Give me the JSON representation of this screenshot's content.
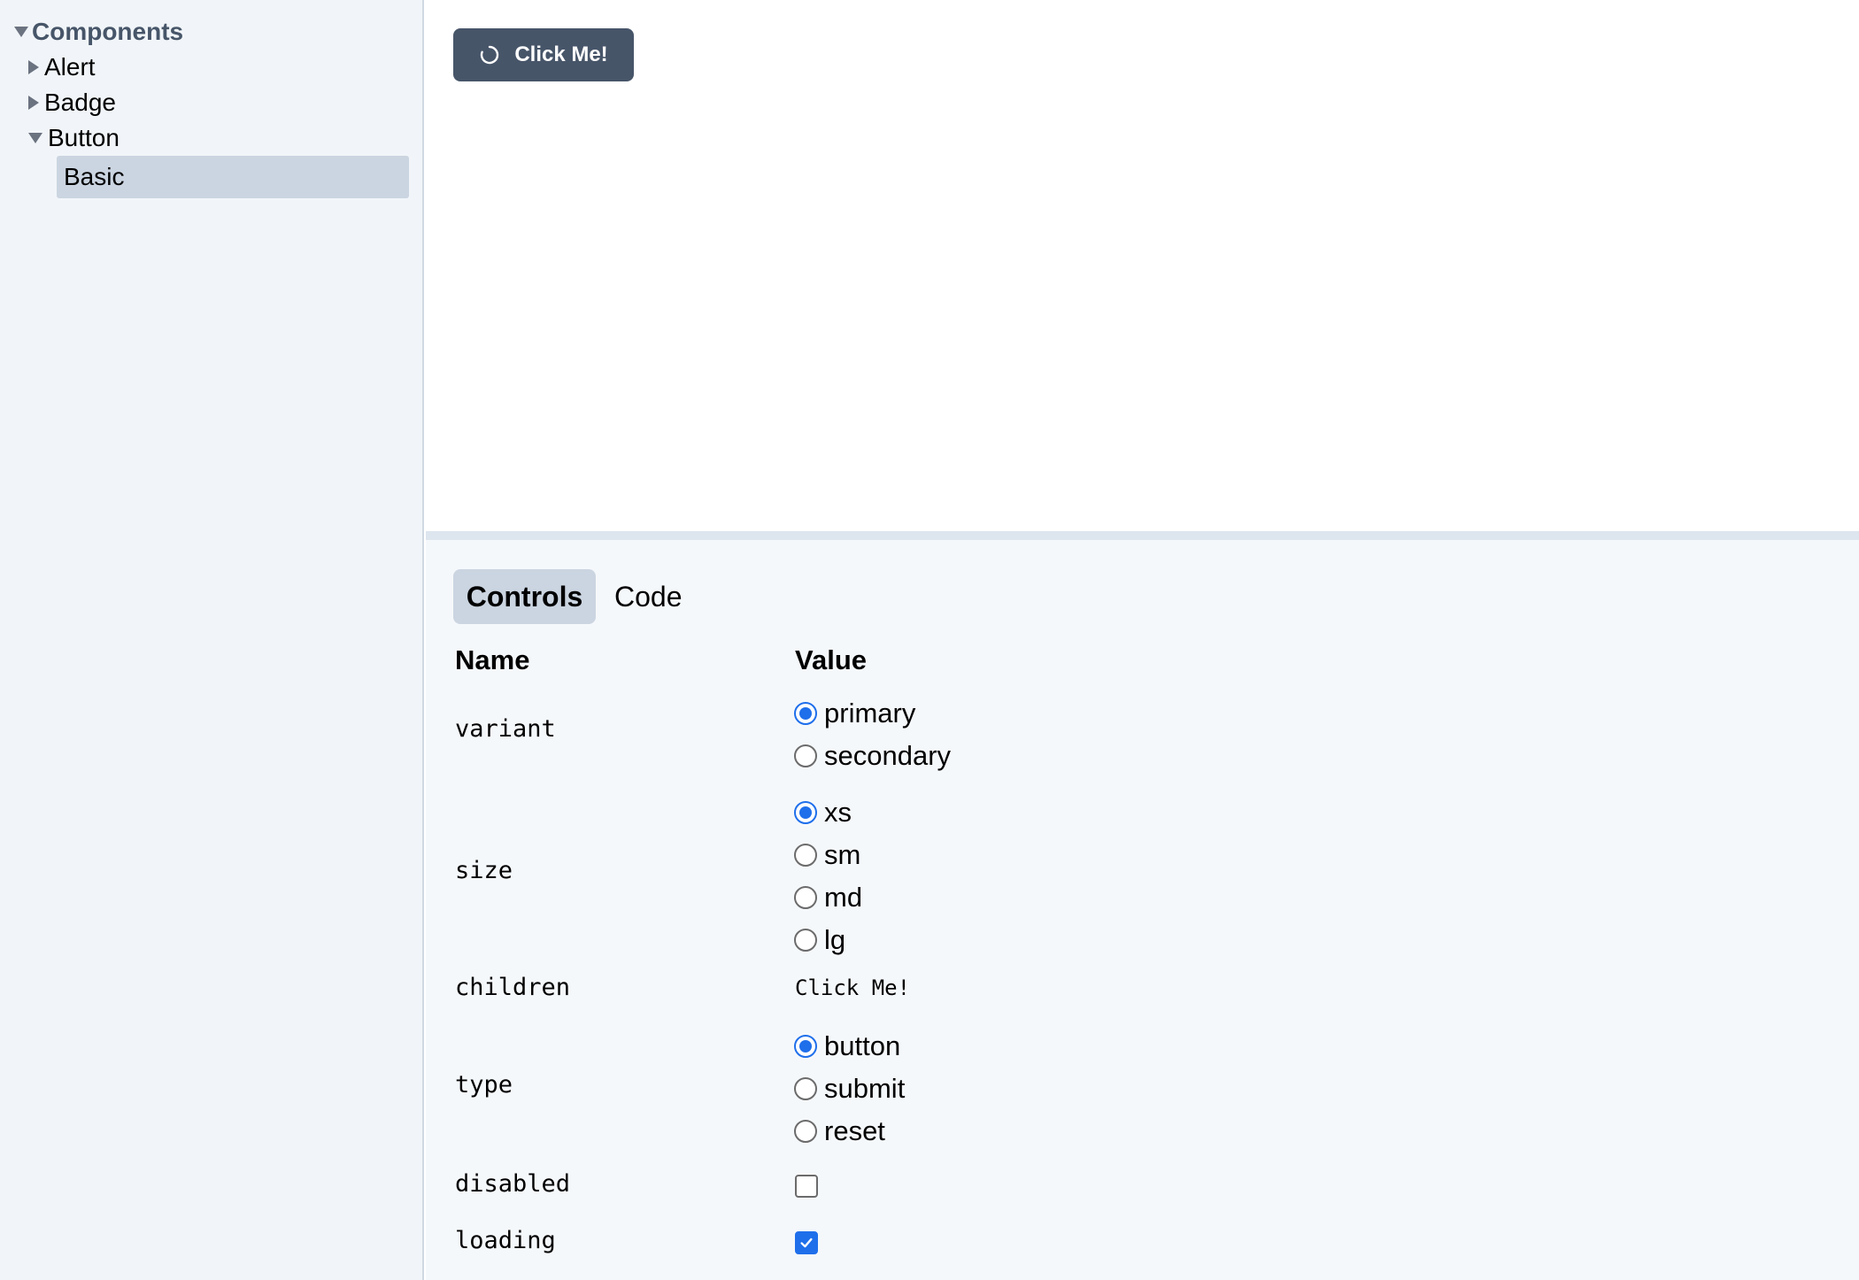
{
  "sidebar": {
    "root": {
      "label": "Components",
      "expanded": true
    },
    "groups": [
      {
        "label": "Alert",
        "expanded": false
      },
      {
        "label": "Badge",
        "expanded": false
      },
      {
        "label": "Button",
        "expanded": true
      }
    ],
    "selected_story": "Basic"
  },
  "preview": {
    "button_label": "Click Me!",
    "button_color": "#475569"
  },
  "panel": {
    "tabs": [
      {
        "label": "Controls",
        "active": true
      },
      {
        "label": "Code",
        "active": false
      }
    ],
    "columns": {
      "name": "Name",
      "value": "Value"
    },
    "props": {
      "variant": {
        "name": "variant",
        "options": [
          "primary",
          "secondary"
        ],
        "selected": "primary"
      },
      "size": {
        "name": "size",
        "options": [
          "xs",
          "sm",
          "md",
          "lg"
        ],
        "selected": "xs"
      },
      "children": {
        "name": "children",
        "value": "Click Me!"
      },
      "type": {
        "name": "type",
        "options": [
          "button",
          "submit",
          "reset"
        ],
        "selected": "button"
      },
      "disabled": {
        "name": "disabled",
        "checked": false
      },
      "loading": {
        "name": "loading",
        "checked": true
      }
    }
  },
  "colors": {
    "accent": "#1f6feb",
    "sidebar_bg": "#f1f5f9",
    "selected_bg": "#cbd5e1",
    "panel_bg": "#f5f8fb"
  }
}
